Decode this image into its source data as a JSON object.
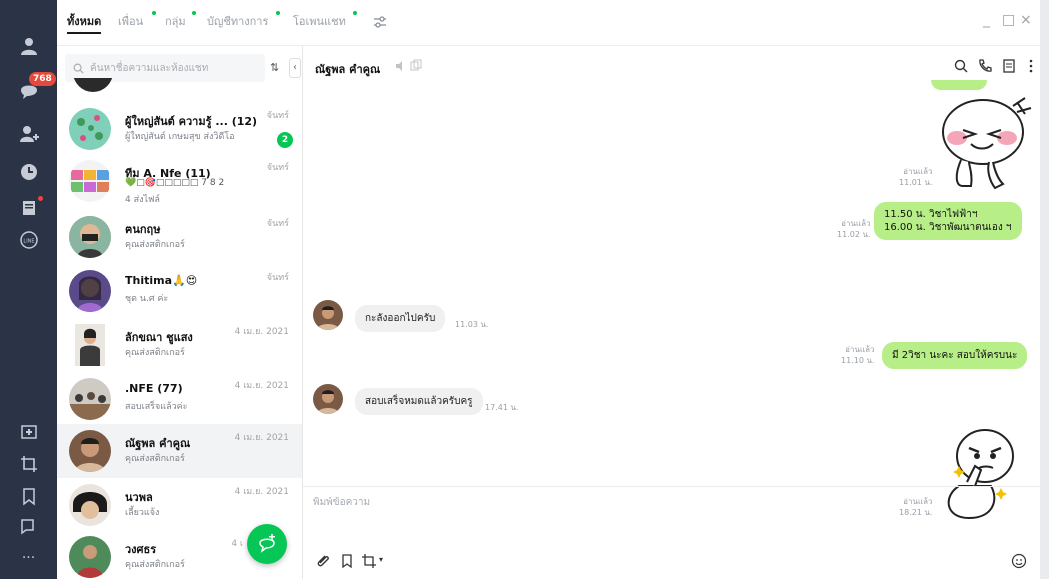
{
  "tabs": [
    {
      "label": "ทั้งหมด",
      "active": true
    },
    {
      "label": "เพื่อน",
      "dot": true
    },
    {
      "label": "กลุ่ม",
      "dot": true
    },
    {
      "label": "บัญชีทางการ",
      "dot": true
    },
    {
      "label": "โอเพนแชท",
      "dot": true
    }
  ],
  "window_controls": {
    "minimize": "_",
    "maximize": "□",
    "close": "×"
  },
  "rail": {
    "chat_badge": "768"
  },
  "search": {
    "placeholder": "ค้นหาชื่อความและห้องแชท",
    "sort": "⇅",
    "collapse": "‹"
  },
  "chats": [
    {
      "name": "ผู้ใหญ่สันต์ ความรู้ ... (12)",
      "preview": "ผู้ใหญ่สันต์ เกษมสุข ส่งวิดีโอ",
      "date": "จันทร์",
      "unread": "2"
    },
    {
      "name": "ทีม A.  Nfe (11)",
      "preview": "💚□🎯□□□□□ 7 8 2",
      "preview2": "4 ส่งไฟล์",
      "date": "จันทร์"
    },
    {
      "name": "ฅนกฤษ",
      "preview": "คุณส่งสติกเกอร์",
      "date": "จันทร์"
    },
    {
      "name": "Thitima🙏😍",
      "preview": "ชุด น.ศ ค่ะ",
      "date": "จันทร์"
    },
    {
      "name": "ลักขณา ชูแสง",
      "preview": "คุณส่งสติกเกอร์",
      "date": "4 เม.ย. 2021"
    },
    {
      "name": ".NFE (77)",
      "preview": "สอบเสร็จแล้วค่ะ",
      "date": "4 เม.ย. 2021"
    },
    {
      "name": "ณัฐพล คำคูณ",
      "preview": "คุณส่งสติกเกอร์",
      "date": "4 เม.ย. 2021",
      "selected": true
    },
    {
      "name": "นวพล",
      "preview": "เลี้ยวแจ้ง",
      "date": "4 เม.ย. 2021"
    },
    {
      "name": "วงศธร",
      "preview": "คุณส่งสติกเกอร์",
      "date": "4 เ"
    }
  ],
  "chat": {
    "title": "ณัฐพล คำคูณ",
    "messages": [
      {
        "dir": "out",
        "type": "sticker",
        "read": "อ่านแล้ว",
        "time": "11.01 น."
      },
      {
        "dir": "out",
        "type": "text",
        "line1": "11.50 น.  วิชาไฟฟ้าฯ",
        "line2": "16.00 น.  วิชาพัฒนาตนเอง ฯ",
        "read": "อ่านแล้ว",
        "time": "11.02 น."
      },
      {
        "dir": "in",
        "type": "text",
        "text": "กะลังออกไปครับ",
        "time": "11.03 น."
      },
      {
        "dir": "out",
        "type": "text",
        "text": "มี 2วิชา นะคะ สอบให้ครบนะ",
        "read": "อ่านแล้ว",
        "time": "11.10 น."
      },
      {
        "dir": "in",
        "type": "text",
        "text": "สอบเสร็จหมดแล้วครับครู",
        "time": "17.41 น."
      },
      {
        "dir": "out",
        "type": "sticker",
        "read": "อ่านแล้ว",
        "time": "18.21 น."
      }
    ],
    "compose_placeholder": "พิมพ์ข้อความ"
  },
  "colors": {
    "rail": "#2b3346",
    "accent": "#06c755",
    "bubble_out": "#b8ee87",
    "bubble_in": "#f0f0f0",
    "badge": "#e8473b"
  },
  "icons": [
    "user-icon",
    "chat-icon",
    "add-friend-icon",
    "clock-icon",
    "note-icon",
    "line-icon",
    "add-square-icon",
    "crop-icon",
    "bookmark-icon",
    "speech-icon",
    "more-icon",
    "search-icon",
    "phone-icon",
    "notes-icon",
    "menu-dots-icon",
    "attach-icon",
    "emoji-icon"
  ]
}
